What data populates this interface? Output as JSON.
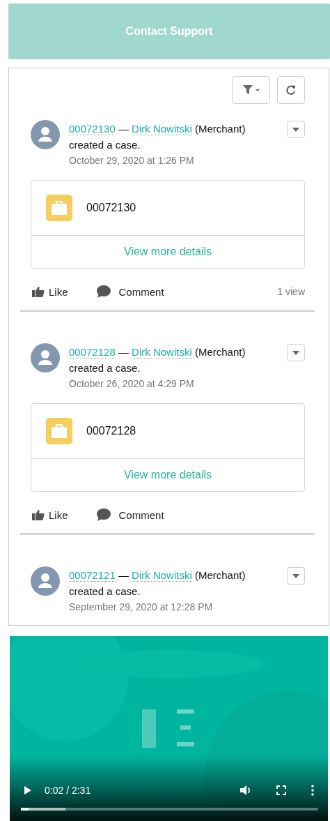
{
  "contact_button": {
    "label": "Contact Support"
  },
  "feed": {
    "posts": [
      {
        "case_number": "00072130",
        "separator": "—",
        "author": "Dirk Nowitski",
        "role": "(Merchant)",
        "action": "created a case.",
        "date": "October 29, 2020 at 1:26 PM",
        "card": {
          "case_number": "00072130",
          "link": "View more details"
        },
        "actions": {
          "like": "Like",
          "comment": "Comment",
          "views": "1 view"
        }
      },
      {
        "case_number": "00072128",
        "separator": "—",
        "author": "Dirk Nowitski",
        "role": "(Merchant)",
        "action": "created a case.",
        "date": "October 26, 2020 at 4:29 PM",
        "card": {
          "case_number": "00072128",
          "link": "View more details"
        },
        "actions": {
          "like": "Like",
          "comment": "Comment"
        }
      },
      {
        "case_number": "00072121",
        "separator": "—",
        "author": "Dirk Nowitski",
        "role": "(Merchant)",
        "action": "created a case.",
        "date": "September 29, 2020 at 12:28 PM"
      }
    ]
  },
  "video": {
    "time": "0:02 / 2:31",
    "progress": {
      "level": 0.025
    }
  }
}
